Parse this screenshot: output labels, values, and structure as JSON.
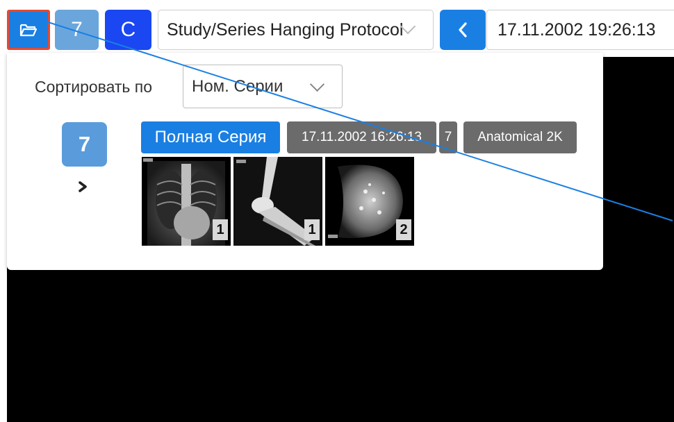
{
  "toolbar": {
    "study_number": "7",
    "c_button": "C",
    "hanging_protocol": "Study/Series Hanging Protocol",
    "datetime": "17.11.2002 19:26:13"
  },
  "panel": {
    "sort_label": "Сортировать по",
    "sort_value": "Ном. Серии",
    "study_number": "7",
    "series_label": "Полная Серия",
    "series_date": "17.11.2002 16:26:13",
    "series_number": "7",
    "series_description": "Anatomical 2K",
    "thumbnails": [
      {
        "kind": "chest-xray",
        "count": "1"
      },
      {
        "kind": "knee-xray",
        "count": "1"
      },
      {
        "kind": "mammogram",
        "count": "2"
      }
    ]
  },
  "colors": {
    "primary_blue": "#1a7fe3",
    "light_blue": "#6aa6dc",
    "dark_blue": "#1a47f2",
    "tag_gray": "#6b6b6b",
    "selection_border": "#e34a32",
    "viewport": "#000000"
  },
  "icons": {
    "open": "folder-open-icon",
    "prev": "chevron-left-icon",
    "expand": "chevron-right-icon",
    "dropdown": "chevron-down-icon"
  }
}
